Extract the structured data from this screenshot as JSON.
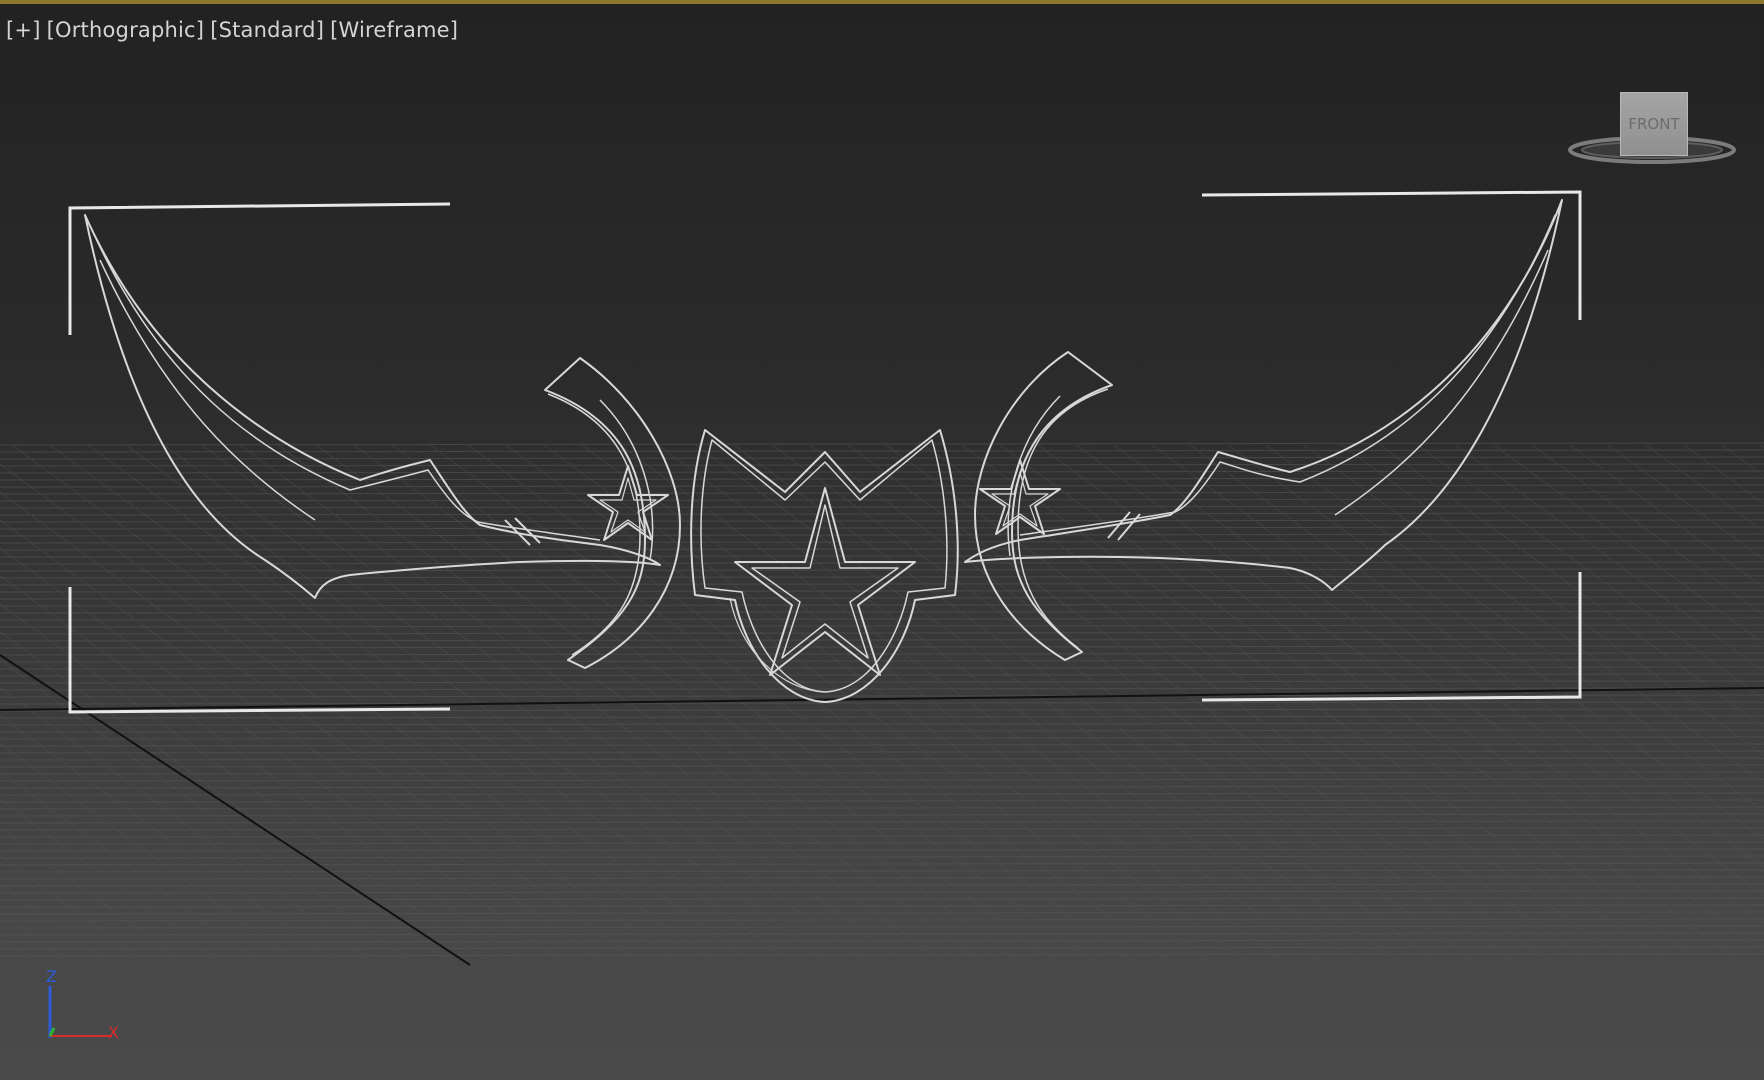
{
  "viewport": {
    "labels": [
      "[+]",
      "[Orthographic]",
      "[Standard]",
      "[Wireframe]"
    ],
    "active_border_color": "#8c7a2a",
    "background_top": "#222222",
    "background_bottom": "#4a4a4a",
    "wireframe_color": "#d8d8d8",
    "grid_color": "#585858"
  },
  "viewcube": {
    "face_label": "FRONT"
  },
  "axis_tripod": {
    "z_label": "Z",
    "x_label": "X",
    "z_color": "#2d5bd6",
    "x_color": "#d62d2d",
    "y_color": "#2db52d"
  }
}
